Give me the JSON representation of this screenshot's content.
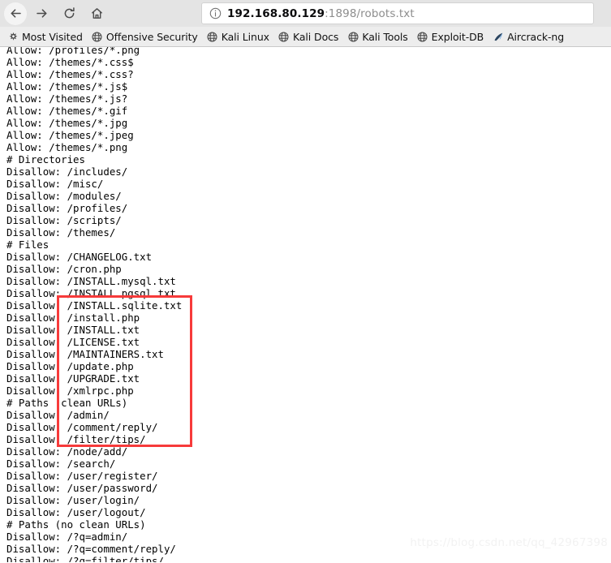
{
  "toolbar": {
    "back_label": "Back",
    "forward_label": "Forward",
    "reload_label": "Reload",
    "home_label": "Home",
    "url_host": "192.168.80.129",
    "url_rest": ":1898/robots.txt",
    "url_full": "192.168.80.129:1898/robots.txt",
    "site_info_icon": "info-circle-icon"
  },
  "bookmarks": {
    "items": [
      {
        "label": "Most Visited",
        "icon": "gear-icon"
      },
      {
        "label": "Offensive Security",
        "icon": "globe-icon"
      },
      {
        "label": "Kali Linux",
        "icon": "globe-icon"
      },
      {
        "label": "Kali Docs",
        "icon": "globe-icon"
      },
      {
        "label": "Kali Tools",
        "icon": "globe-icon"
      },
      {
        "label": "Exploit-DB",
        "icon": "globe-icon"
      },
      {
        "label": "Aircrack-ng",
        "icon": "aircrack-icon"
      }
    ]
  },
  "page": {
    "robots_txt": "Allow: /profiles/*.png\nAllow: /themes/*.css$\nAllow: /themes/*.css?\nAllow: /themes/*.js$\nAllow: /themes/*.js?\nAllow: /themes/*.gif\nAllow: /themes/*.jpg\nAllow: /themes/*.jpeg\nAllow: /themes/*.png\n# Directories\nDisallow: /includes/\nDisallow: /misc/\nDisallow: /modules/\nDisallow: /profiles/\nDisallow: /scripts/\nDisallow: /themes/\n# Files\nDisallow: /CHANGELOG.txt\nDisallow: /cron.php\nDisallow: /INSTALL.mysql.txt\nDisallow: /INSTALL.pgsql.txt\nDisallow: /INSTALL.sqlite.txt\nDisallow: /install.php\nDisallow: /INSTALL.txt\nDisallow: /LICENSE.txt\nDisallow: /MAINTAINERS.txt\nDisallow: /update.php\nDisallow: /UPGRADE.txt\nDisallow: /xmlrpc.php\n# Paths (clean URLs)\nDisallow: /admin/\nDisallow: /comment/reply/\nDisallow: /filter/tips/\nDisallow: /node/add/\nDisallow: /search/\nDisallow: /user/register/\nDisallow: /user/password/\nDisallow: /user/login/\nDisallow: /user/logout/\n# Paths (no clean URLs)\nDisallow: /?q=admin/\nDisallow: /?q=comment/reply/\nDisallow: /?q=filter/tips/",
    "highlight_color": "#f73a3a",
    "watermark": "https://blog.csdn.net/qq_42967398"
  }
}
